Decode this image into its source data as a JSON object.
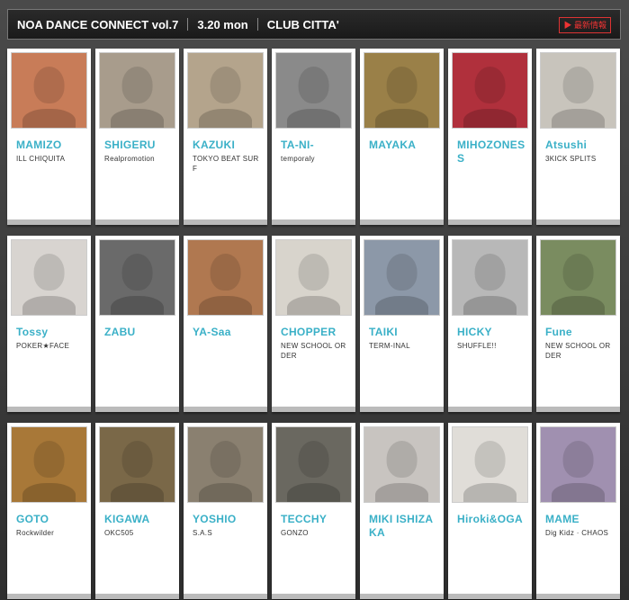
{
  "header": {
    "title": "NOA DANCE CONNECT vol.7",
    "date": "3.20 mon",
    "venue": "CLUB CITTA'",
    "link": "▶ 最新情報"
  },
  "dancers": [
    {
      "name": "MAMIZO",
      "crew": "ILL CHIQUITA",
      "color": "#c87c58"
    },
    {
      "name": "SHIGERU",
      "crew": "Realpromotion",
      "color": "#a89c8c"
    },
    {
      "name": "KAZUKI",
      "crew": "TOKYO BEAT SURF",
      "color": "#b4a48c"
    },
    {
      "name": "TA-NI-",
      "crew": "temporaly",
      "color": "#8a8a8a"
    },
    {
      "name": "MAYAKA",
      "crew": "",
      "color": "#9a8048"
    },
    {
      "name": "MIHOZONESS",
      "crew": "",
      "color": "#b0303c"
    },
    {
      "name": "Atsushi",
      "crew": "3KICK SPLITS",
      "color": "#c8c4bc"
    },
    {
      "name": "Tossy",
      "crew": "POKER★FACE",
      "color": "#d8d4d0"
    },
    {
      "name": "ZABU",
      "crew": "",
      "color": "#6a6a6a"
    },
    {
      "name": "YA-Saa",
      "crew": "",
      "color": "#b07850"
    },
    {
      "name": "CHOPPER",
      "crew": "NEW SCHOOL ORDER",
      "color": "#d8d4cc"
    },
    {
      "name": "TAIKI",
      "crew": "TERM-INAL",
      "color": "#8c98a8"
    },
    {
      "name": "HICKY",
      "crew": "SHUFFLE!!",
      "color": "#b8b8b8"
    },
    {
      "name": "Fune",
      "crew": "NEW SCHOOL ORDER",
      "color": "#7a8c60"
    },
    {
      "name": "GOTO",
      "crew": "Rockwilder",
      "color": "#a87838"
    },
    {
      "name": "KIGAWA",
      "crew": "OKC505",
      "color": "#7a6848"
    },
    {
      "name": "YOSHIO",
      "crew": "S.A.S",
      "color": "#8a8070"
    },
    {
      "name": "TECCHY",
      "crew": "GONZO",
      "color": "#6a6860"
    },
    {
      "name": "MIKI ISHIZAKA",
      "crew": "",
      "color": "#c8c4c0"
    },
    {
      "name": "Hiroki&OGA",
      "crew": "",
      "color": "#e0ddd8"
    },
    {
      "name": "MAME",
      "crew": "Dig Kidz · CHAOS",
      "color": "#a090b0"
    }
  ]
}
